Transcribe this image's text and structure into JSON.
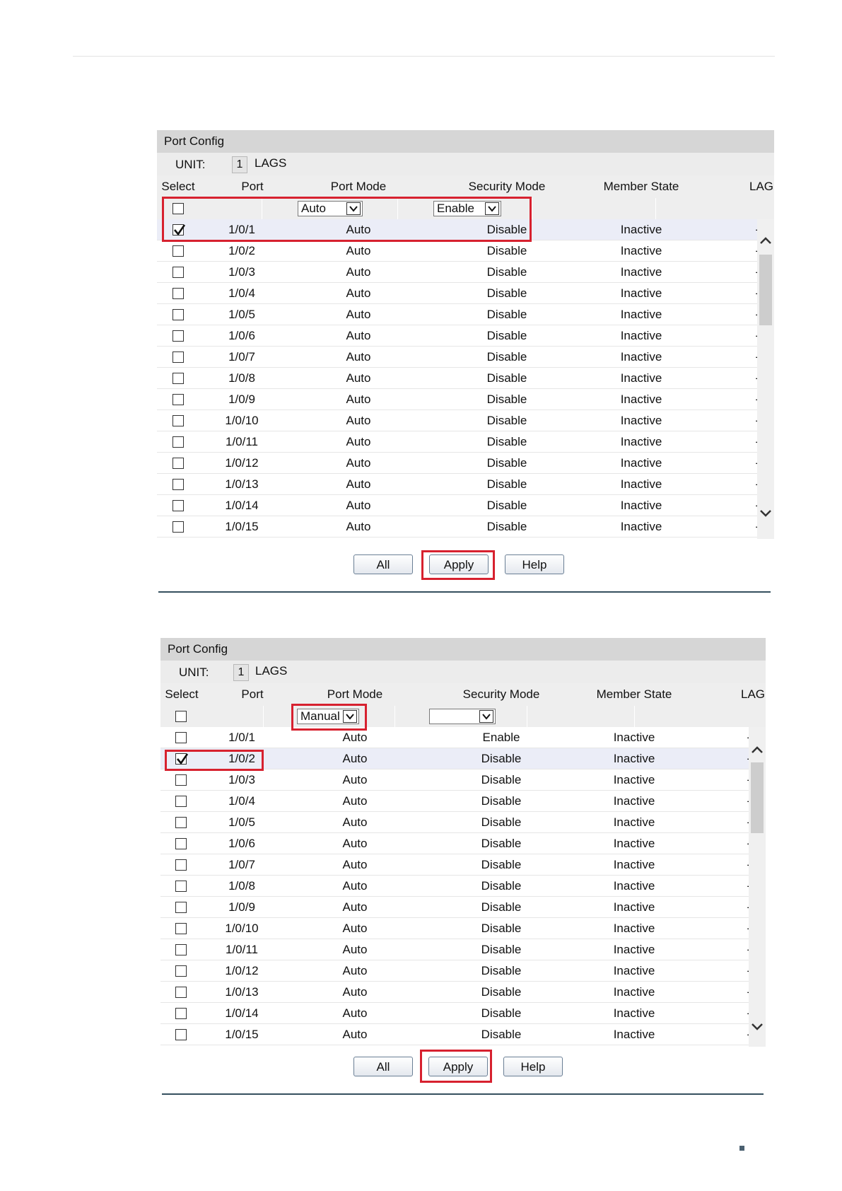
{
  "panel_title": "Port Config",
  "unit": {
    "label": "UNIT:",
    "value": "1",
    "lags": "LAGS"
  },
  "columns": [
    "Select",
    "Port",
    "Port Mode",
    "Security Mode",
    "Member State",
    "LAG"
  ],
  "buttons": {
    "all": "All",
    "apply": "Apply",
    "help": "Help"
  },
  "config1": {
    "port_mode_select": "Auto",
    "security_mode_select": "Enable",
    "rows": [
      {
        "checked": true,
        "port": "1/0/1",
        "mode": "Auto",
        "security": "Disable",
        "state": "Inactive",
        "lag": "---"
      },
      {
        "checked": false,
        "port": "1/0/2",
        "mode": "Auto",
        "security": "Disable",
        "state": "Inactive",
        "lag": "---"
      },
      {
        "checked": false,
        "port": "1/0/3",
        "mode": "Auto",
        "security": "Disable",
        "state": "Inactive",
        "lag": "---"
      },
      {
        "checked": false,
        "port": "1/0/4",
        "mode": "Auto",
        "security": "Disable",
        "state": "Inactive",
        "lag": "---"
      },
      {
        "checked": false,
        "port": "1/0/5",
        "mode": "Auto",
        "security": "Disable",
        "state": "Inactive",
        "lag": "---"
      },
      {
        "checked": false,
        "port": "1/0/6",
        "mode": "Auto",
        "security": "Disable",
        "state": "Inactive",
        "lag": "---"
      },
      {
        "checked": false,
        "port": "1/0/7",
        "mode": "Auto",
        "security": "Disable",
        "state": "Inactive",
        "lag": "---"
      },
      {
        "checked": false,
        "port": "1/0/8",
        "mode": "Auto",
        "security": "Disable",
        "state": "Inactive",
        "lag": "---"
      },
      {
        "checked": false,
        "port": "1/0/9",
        "mode": "Auto",
        "security": "Disable",
        "state": "Inactive",
        "lag": "---"
      },
      {
        "checked": false,
        "port": "1/0/10",
        "mode": "Auto",
        "security": "Disable",
        "state": "Inactive",
        "lag": "---"
      },
      {
        "checked": false,
        "port": "1/0/11",
        "mode": "Auto",
        "security": "Disable",
        "state": "Inactive",
        "lag": "---"
      },
      {
        "checked": false,
        "port": "1/0/12",
        "mode": "Auto",
        "security": "Disable",
        "state": "Inactive",
        "lag": "---"
      },
      {
        "checked": false,
        "port": "1/0/13",
        "mode": "Auto",
        "security": "Disable",
        "state": "Inactive",
        "lag": "---"
      },
      {
        "checked": false,
        "port": "1/0/14",
        "mode": "Auto",
        "security": "Disable",
        "state": "Inactive",
        "lag": "---"
      },
      {
        "checked": false,
        "port": "1/0/15",
        "mode": "Auto",
        "security": "Disable",
        "state": "Inactive",
        "lag": "---"
      }
    ]
  },
  "config2": {
    "port_mode_select": "Manual",
    "security_mode_select": "",
    "rows": [
      {
        "checked": false,
        "port": "1/0/1",
        "mode": "Auto",
        "security": "Enable",
        "state": "Inactive",
        "lag": "---"
      },
      {
        "checked": true,
        "port": "1/0/2",
        "mode": "Auto",
        "security": "Disable",
        "state": "Inactive",
        "lag": "---"
      },
      {
        "checked": false,
        "port": "1/0/3",
        "mode": "Auto",
        "security": "Disable",
        "state": "Inactive",
        "lag": "---"
      },
      {
        "checked": false,
        "port": "1/0/4",
        "mode": "Auto",
        "security": "Disable",
        "state": "Inactive",
        "lag": "---"
      },
      {
        "checked": false,
        "port": "1/0/5",
        "mode": "Auto",
        "security": "Disable",
        "state": "Inactive",
        "lag": "---"
      },
      {
        "checked": false,
        "port": "1/0/6",
        "mode": "Auto",
        "security": "Disable",
        "state": "Inactive",
        "lag": "---"
      },
      {
        "checked": false,
        "port": "1/0/7",
        "mode": "Auto",
        "security": "Disable",
        "state": "Inactive",
        "lag": "---"
      },
      {
        "checked": false,
        "port": "1/0/8",
        "mode": "Auto",
        "security": "Disable",
        "state": "Inactive",
        "lag": "---"
      },
      {
        "checked": false,
        "port": "1/0/9",
        "mode": "Auto",
        "security": "Disable",
        "state": "Inactive",
        "lag": "---"
      },
      {
        "checked": false,
        "port": "1/0/10",
        "mode": "Auto",
        "security": "Disable",
        "state": "Inactive",
        "lag": "---"
      },
      {
        "checked": false,
        "port": "1/0/11",
        "mode": "Auto",
        "security": "Disable",
        "state": "Inactive",
        "lag": "---"
      },
      {
        "checked": false,
        "port": "1/0/12",
        "mode": "Auto",
        "security": "Disable",
        "state": "Inactive",
        "lag": "---"
      },
      {
        "checked": false,
        "port": "1/0/13",
        "mode": "Auto",
        "security": "Disable",
        "state": "Inactive",
        "lag": "---"
      },
      {
        "checked": false,
        "port": "1/0/14",
        "mode": "Auto",
        "security": "Disable",
        "state": "Inactive",
        "lag": "---"
      },
      {
        "checked": false,
        "port": "1/0/15",
        "mode": "Auto",
        "security": "Disable",
        "state": "Inactive",
        "lag": "---"
      }
    ]
  },
  "colors": {
    "highlight": "#d7212f",
    "selected_row": "#ebedf7",
    "header": "#d6d6d6",
    "rule": "#35505e"
  }
}
